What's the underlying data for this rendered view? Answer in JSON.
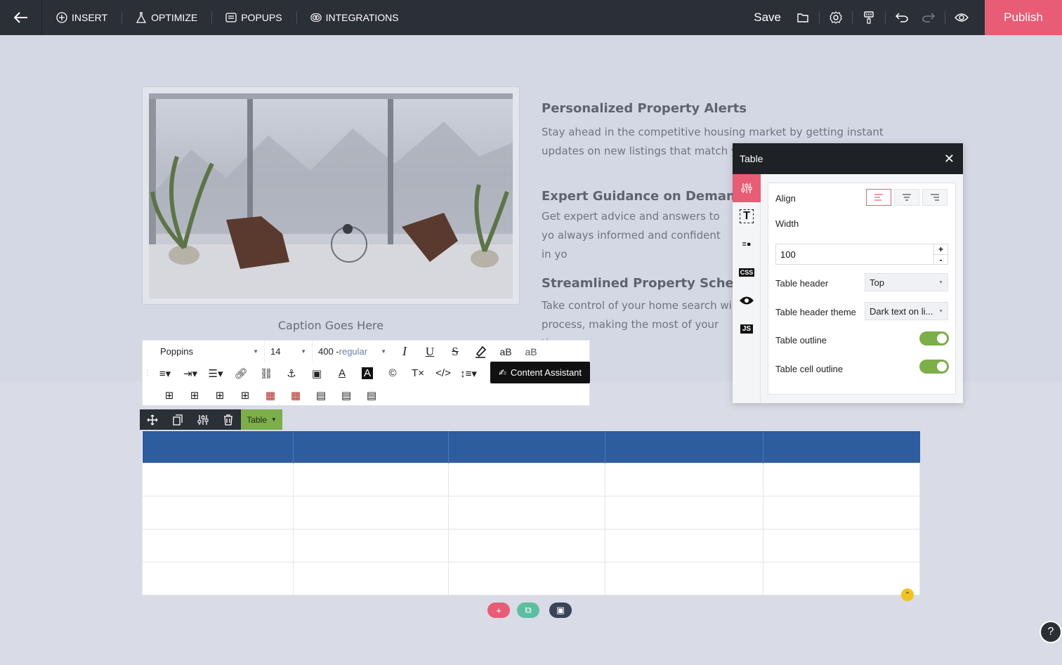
{
  "topbar": {
    "nav": [
      {
        "label": "INSERT",
        "icon": "plus-circle-icon"
      },
      {
        "label": "OPTIMIZE",
        "icon": "flask-icon"
      },
      {
        "label": "POPUPS",
        "icon": "window-icon"
      },
      {
        "label": "INTEGRATIONS",
        "icon": "link-rings-icon"
      }
    ],
    "save_label": "Save",
    "publish_label": "Publish"
  },
  "content": {
    "caption": "Caption Goes Here",
    "features": [
      {
        "title": "Personalized Property Alerts",
        "text": "Stay ahead in the competitive housing market by getting instant updates on new listings that match y"
      },
      {
        "title": "Expert Guidance on Demand",
        "text": "Get expert advice and answers to yo always informed and confident in yo"
      },
      {
        "title": "Streamlined Property Schedu",
        "text": "Take control of your home search wi process, making the most of your tin"
      }
    ]
  },
  "editor_toolbar": {
    "font_family": "Poppins",
    "font_size": "14",
    "font_weight": "400 -",
    "font_weight_style": "regular",
    "content_assistant_label": "Content Assistant"
  },
  "element_toolbar": {
    "label": "Table"
  },
  "table": {
    "columns": 5,
    "rows": 4,
    "header_color": "#2d5d9f"
  },
  "panel": {
    "title": "Table",
    "align_label": "Align",
    "width_label": "Width",
    "width_value": "100",
    "table_header_label": "Table header",
    "table_header_value": "Top",
    "table_header_theme_label": "Table header theme",
    "table_header_theme_value": "Dark text on li...",
    "table_outline_label": "Table outline",
    "table_cell_outline_label": "Table cell outline",
    "accent_color": "#e85d75",
    "toggle_color": "#7cae4a"
  }
}
